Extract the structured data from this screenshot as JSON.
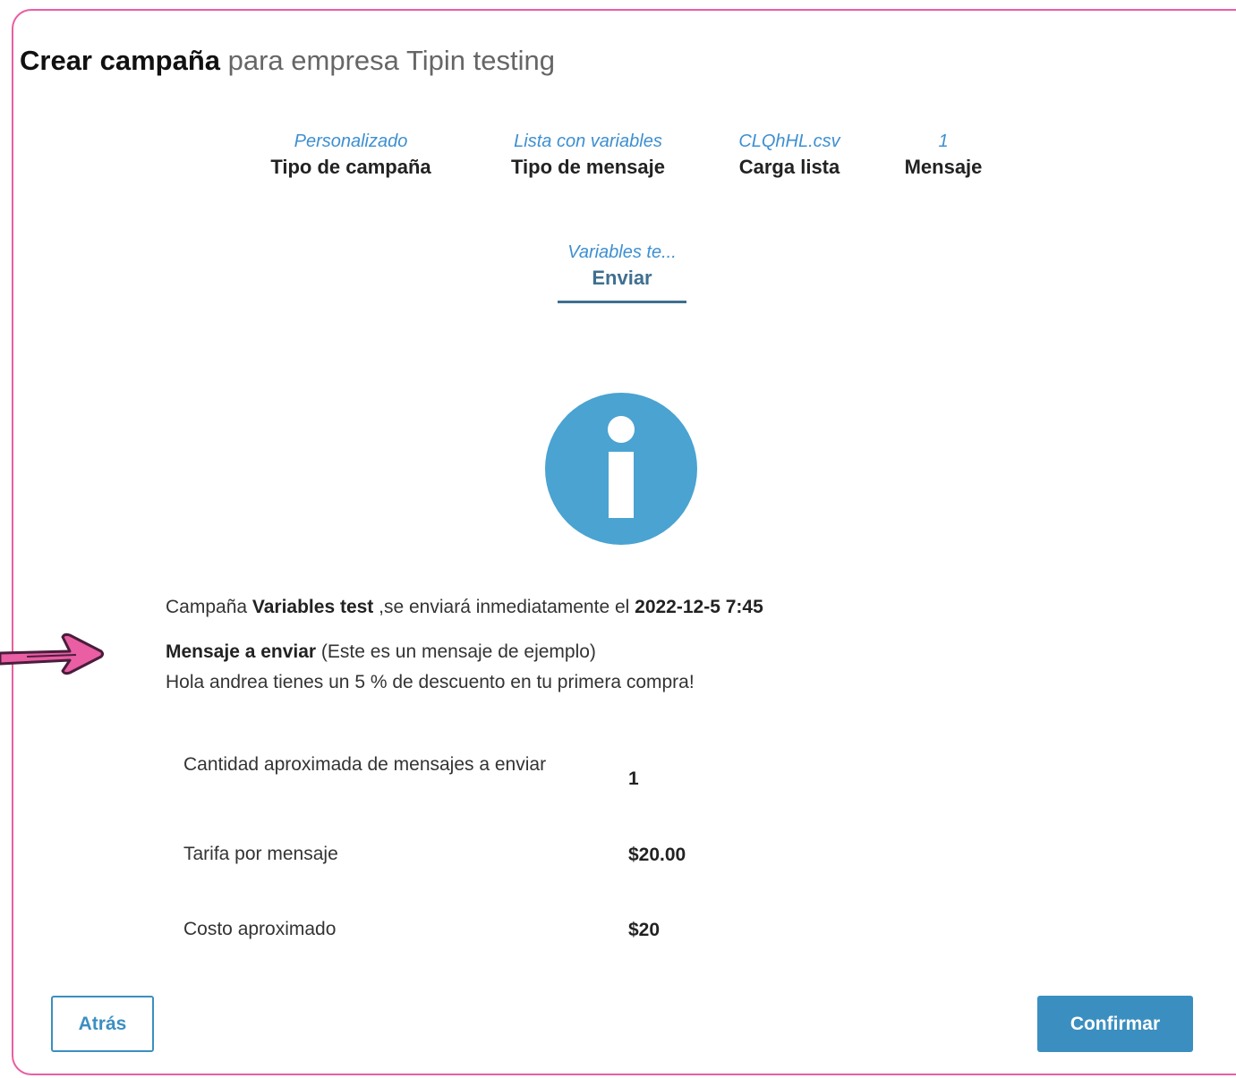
{
  "title": {
    "bold": "Crear campaña",
    "rest": " para empresa Tipin testing"
  },
  "steps": [
    {
      "value": "Personalizado",
      "label": "Tipo de campaña"
    },
    {
      "value": "Lista con variables",
      "label": "Tipo de mensaje"
    },
    {
      "value": "CLQhHL.csv",
      "label": "Carga lista"
    },
    {
      "value": "1",
      "label": "Mensaje"
    },
    {
      "value": "Variables te...",
      "label": "Enviar"
    }
  ],
  "summary": {
    "line1_prefix": "Campaña ",
    "campaign_name": "Variables test",
    "line1_middle": " ,se enviará inmediatamente el ",
    "send_date": "2022-12-5 7:45",
    "message_heading": "Mensaje a enviar",
    "message_note": " (Este es un mensaje de ejemplo)",
    "message_text": "Hola andrea tienes un 5 % de descuento en tu primera compra!"
  },
  "costs": [
    {
      "label": "Cantidad aproximada de mensajes a enviar",
      "value": "1"
    },
    {
      "label": "Tarifa por mensaje",
      "value": "$20.00"
    },
    {
      "label": "Costo aproximado",
      "value": "$20"
    }
  ],
  "buttons": {
    "back": "Atrás",
    "confirm": "Confirmar"
  },
  "colors": {
    "accent": "#3b8fc0",
    "frame": "#ea5ea3",
    "step_value": "#3d8fd1",
    "info_icon": "#4aa3d1"
  }
}
